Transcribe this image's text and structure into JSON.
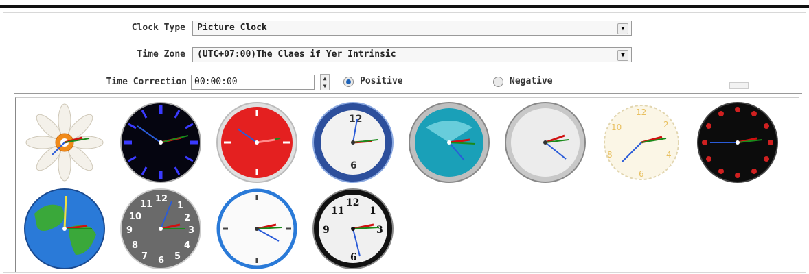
{
  "form": {
    "clock_type_label": "Clock Type",
    "clock_type_value": "Picture Clock",
    "time_zone_label": "Time Zone",
    "time_zone_value": "(UTC+07:00)The Claes if Yer Intrinsic",
    "time_correction_label": "Time Correction",
    "time_correction_value": "00:00:00",
    "positive_label": "Positive",
    "negative_label": "Negative",
    "selected_direction": "Positive"
  },
  "clocks": [
    {
      "name": "daisy-clock-icon"
    },
    {
      "name": "neon-blue-clock-icon"
    },
    {
      "name": "red-clock-icon"
    },
    {
      "name": "blue-ring-clock-icon"
    },
    {
      "name": "teal-clock-icon"
    },
    {
      "name": "silver-clock-icon"
    },
    {
      "name": "ornate-clock-icon"
    },
    {
      "name": "black-red-dots-clock-icon"
    },
    {
      "name": "globe-clock-icon"
    },
    {
      "name": "gray-numbers-clock-icon"
    },
    {
      "name": "white-blue-rim-clock-icon"
    },
    {
      "name": "black-white-clock-icon"
    }
  ],
  "colors": {
    "radio_selected": "#1c62b8",
    "hour_hand": "#d01010",
    "minute_hand": "#2a5bd8",
    "second_hand": "#1a8a1a"
  }
}
